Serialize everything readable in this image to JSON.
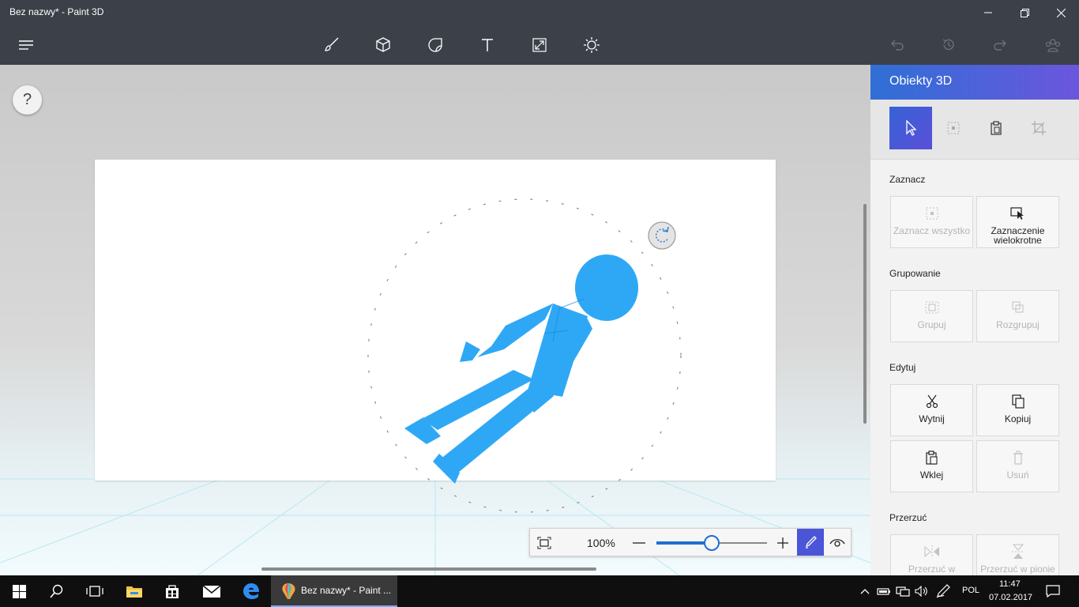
{
  "window": {
    "title": "Bez nazwy* - Paint 3D"
  },
  "toolbar": {
    "buttons": [
      "menu-icon",
      "brush-icon",
      "cube-icon",
      "sticker-icon",
      "text-icon",
      "resize-icon",
      "effects-icon",
      "undo-icon",
      "history-icon",
      "redo-icon",
      "remix-icon"
    ]
  },
  "workspace": {
    "help_label": "?",
    "zoom": {
      "percent_label": "100%",
      "level": 0.5
    }
  },
  "panel": {
    "title": "Obiekty 3D",
    "sections": {
      "select": {
        "label": "Zaznacz",
        "buttons": [
          {
            "label": "Zaznacz wszystko",
            "icon": "select-all-icon",
            "enabled": false
          },
          {
            "label": "Zaznaczenie wielokrotne",
            "icon": "multi-select-icon",
            "enabled": true
          }
        ]
      },
      "group": {
        "label": "Grupowanie",
        "buttons": [
          {
            "label": "Grupuj",
            "icon": "group-icon",
            "enabled": false
          },
          {
            "label": "Rozgrupuj",
            "icon": "ungroup-icon",
            "enabled": false
          }
        ]
      },
      "edit": {
        "label": "Edytuj",
        "buttons": [
          {
            "label": "Wytnij",
            "icon": "cut-icon",
            "enabled": true
          },
          {
            "label": "Kopiuj",
            "icon": "copy-icon",
            "enabled": true
          },
          {
            "label": "Wklej",
            "icon": "paste-icon",
            "enabled": true
          },
          {
            "label": "Usuń",
            "icon": "delete-icon",
            "enabled": false
          }
        ]
      },
      "flip": {
        "label": "Przerzuć",
        "buttons": [
          {
            "label": "Przerzuć w",
            "icon": "flip-horizontal-icon",
            "enabled": false
          },
          {
            "label": "Przerzuć w pionie",
            "icon": "flip-vertical-icon",
            "enabled": false
          }
        ]
      }
    }
  },
  "taskbar": {
    "app_label": "Bez nazwy* - Paint ...",
    "language": "POL",
    "time": "11:47",
    "date": "07.02.2017"
  },
  "colors": {
    "chrome": "#3c4048",
    "accent": "#4b55d8",
    "figure": "#2ea8f5"
  }
}
